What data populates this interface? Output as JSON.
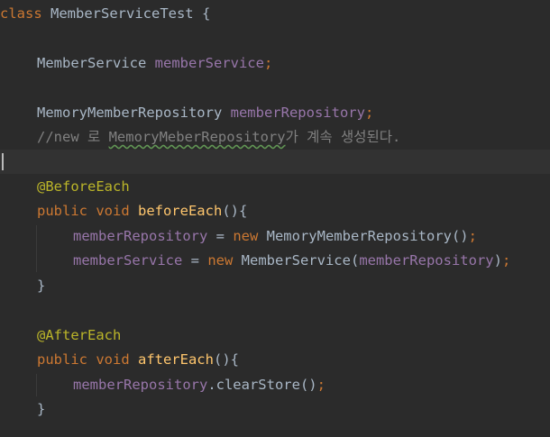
{
  "colors": {
    "background": "#2b2b2b",
    "keyword": "#cc7832",
    "method": "#ffc66d",
    "field": "#9876aa",
    "comment": "#808080",
    "annotation": "#bbb529",
    "text": "#a9b7c6"
  },
  "code": {
    "class_keyword": "class",
    "class_name": " MemberServiceTest {",
    "l2_type": "MemberService ",
    "l2_field": "memberService",
    "l2_semi": ";",
    "l3_type": "MemoryMemberRepository ",
    "l3_field": "memberRepository",
    "l3_semi": ";",
    "comment_prefix": "//new 로 ",
    "comment_typo": "MemoryMeberRepository",
    "comment_suffix": "가 계속 생성된다.",
    "before_annotation": "@BeforeEach",
    "before_mod": "public void ",
    "before_name": "beforeEach",
    "before_sig": "(){",
    "be1_field": "memberRepository",
    "be1_eq": " = ",
    "be1_new": "new ",
    "be1_call": "MemoryMemberRepository()",
    "be1_semi": ";",
    "be2_field": "memberService",
    "be2_eq": " = ",
    "be2_new": "new ",
    "be2_call": "MemberService(",
    "be2_arg": "memberRepository",
    "be2_close": ")",
    "be2_semi": ";",
    "close_brace_1": "}",
    "after_annotation": "@AfterEach",
    "after_mod": "public void ",
    "after_name": "afterEach",
    "after_sig": "(){",
    "ae1_field": "memberRepository",
    "ae1_call": ".clearStore()",
    "ae1_semi": ";",
    "close_brace_2": "}"
  }
}
